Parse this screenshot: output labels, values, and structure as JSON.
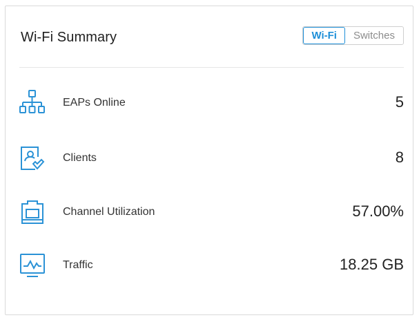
{
  "card": {
    "title": "Wi-Fi Summary",
    "toggle": {
      "options": [
        "Wi-Fi",
        "Switches"
      ],
      "selected": "Wi-Fi"
    }
  },
  "metrics": [
    {
      "label": "EAPs Online",
      "value": "5",
      "icon": "network-topology-icon"
    },
    {
      "label": "Clients",
      "value": "8",
      "icon": "client-device-icon"
    },
    {
      "label": "Channel Utilization",
      "value": "57.00%",
      "icon": "channel-icon"
    },
    {
      "label": "Traffic",
      "value": "18.25 GB",
      "icon": "traffic-monitor-icon"
    }
  ],
  "colors": {
    "accent": "#1e8fd8",
    "icon": "#2a92d6"
  }
}
